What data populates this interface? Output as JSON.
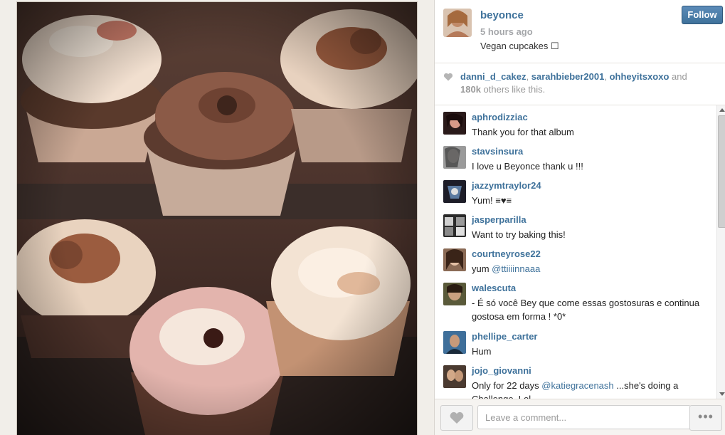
{
  "post": {
    "username": "beyonce",
    "time": "5 hours ago",
    "caption": "Vegan cupcakes ☐",
    "follow_label": "Follow"
  },
  "likes": {
    "users": [
      "danni_d_cakez",
      "sarahbieber2001",
      "ohheyitsxoxo"
    ],
    "and": "and",
    "count": "180k",
    "suffix": "others like this."
  },
  "comments": [
    {
      "user": "aphrodizziac",
      "text": "Thank you for that album"
    },
    {
      "user": "stavsinsura",
      "text": "I love u Beyonce thank u !!!"
    },
    {
      "user": "jazzymtraylor24",
      "text": "Yum! ≡♥≡"
    },
    {
      "user": "jasperparilla",
      "text": "Want to try baking this!"
    },
    {
      "user": "courtneyrose22",
      "text_prefix": "yum ",
      "mention": "@ttiiiinnaaa"
    },
    {
      "user": "walescuta",
      "text": "- É só você Bey que come essas gostosuras e continua gostosa em forma ! *0*"
    },
    {
      "user": "phellipe_carter",
      "text": "Hum"
    },
    {
      "user": "jojo_giovanni",
      "text_prefix": "Only for 22 days ",
      "mention": "@katiegracenash",
      "text_suffix": " ...she's doing a Challenge. Lol"
    }
  ],
  "footer": {
    "comment_placeholder": "Leave a comment...",
    "more_label": "•••"
  },
  "icons": {
    "like": "heart-icon",
    "more": "ellipsis-icon"
  },
  "colors": {
    "link": "#3f729b",
    "follow_button": "#3f729b"
  }
}
